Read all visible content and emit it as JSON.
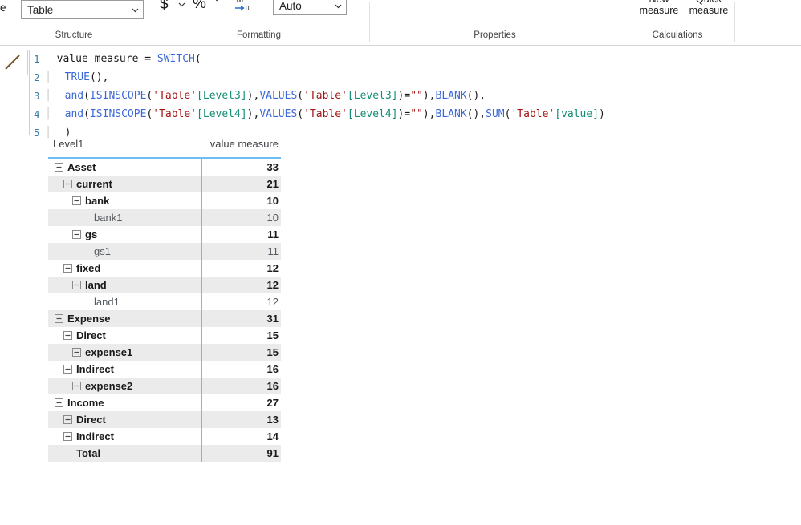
{
  "ribbon": {
    "structure": {
      "group_label": "Structure",
      "truncated_left_label": "e",
      "table_select_value": "Table",
      "table_select_options": [
        "Table"
      ]
    },
    "formatting": {
      "group_label": "Formatting",
      "currency_icon": "$",
      "currency_dropdown_icon": "chevron-down-icon",
      "percent_icon": "%",
      "thousands_icon": "'",
      "decrease_decimals_icon": "decrease-decimal-icon",
      "auto_select_value": "Auto",
      "auto_select_options": [
        "Auto"
      ]
    },
    "properties": {
      "group_label": "Properties"
    },
    "calculations": {
      "group_label": "Calculations",
      "new_measure_label": "New measure",
      "quick_measure_label": "Quick measure"
    }
  },
  "formula_bar": {
    "commit_icon": "checkmark-icon",
    "lines": [
      {
        "number": "1",
        "indent": 0,
        "tokens": [
          {
            "text": "value measure = ",
            "cls": "t-plain"
          },
          {
            "text": "SWITCH",
            "cls": "t-fn"
          },
          {
            "text": "(",
            "cls": "t-punc"
          }
        ]
      },
      {
        "number": "2",
        "indent": 1,
        "tokens": [
          {
            "text": "TRUE",
            "cls": "t-fn"
          },
          {
            "text": "(),",
            "cls": "t-punc"
          }
        ]
      },
      {
        "number": "3",
        "indent": 1,
        "tokens": [
          {
            "text": "and",
            "cls": "t-fn"
          },
          {
            "text": "(",
            "cls": "t-punc"
          },
          {
            "text": "ISINSCOPE",
            "cls": "t-fn"
          },
          {
            "text": "(",
            "cls": "t-punc"
          },
          {
            "text": "'Table'",
            "cls": "t-tbl"
          },
          {
            "text": "[Level3]",
            "cls": "t-col"
          },
          {
            "text": "),",
            "cls": "t-punc"
          },
          {
            "text": "VALUES",
            "cls": "t-fn"
          },
          {
            "text": "(",
            "cls": "t-punc"
          },
          {
            "text": "'Table'",
            "cls": "t-tbl"
          },
          {
            "text": "[Level3]",
            "cls": "t-col"
          },
          {
            "text": ")=",
            "cls": "t-punc"
          },
          {
            "text": "\"\"",
            "cls": "t-str"
          },
          {
            "text": "),",
            "cls": "t-punc"
          },
          {
            "text": "BLANK",
            "cls": "t-fn"
          },
          {
            "text": "(),",
            "cls": "t-punc"
          }
        ]
      },
      {
        "number": "4",
        "indent": 1,
        "tokens": [
          {
            "text": "and",
            "cls": "t-fn"
          },
          {
            "text": "(",
            "cls": "t-punc"
          },
          {
            "text": "ISINSCOPE",
            "cls": "t-fn"
          },
          {
            "text": "(",
            "cls": "t-punc"
          },
          {
            "text": "'Table'",
            "cls": "t-tbl"
          },
          {
            "text": "[Level4]",
            "cls": "t-col"
          },
          {
            "text": "),",
            "cls": "t-punc"
          },
          {
            "text": "VALUES",
            "cls": "t-fn"
          },
          {
            "text": "(",
            "cls": "t-punc"
          },
          {
            "text": "'Table'",
            "cls": "t-tbl"
          },
          {
            "text": "[Level4]",
            "cls": "t-col"
          },
          {
            "text": ")=",
            "cls": "t-punc"
          },
          {
            "text": "\"\"",
            "cls": "t-str"
          },
          {
            "text": "),",
            "cls": "t-punc"
          },
          {
            "text": "BLANK",
            "cls": "t-fn"
          },
          {
            "text": "(),",
            "cls": "t-punc"
          },
          {
            "text": "SUM",
            "cls": "t-fn"
          },
          {
            "text": "(",
            "cls": "t-punc"
          },
          {
            "text": "'Table'",
            "cls": "t-tbl"
          },
          {
            "text": "[value]",
            "cls": "t-col"
          },
          {
            "text": ")",
            "cls": "t-punc"
          }
        ]
      },
      {
        "number": "5",
        "indent": 1,
        "tokens": [
          {
            "text": ")",
            "cls": "t-punc"
          }
        ]
      }
    ]
  },
  "matrix": {
    "columns": {
      "row_header": "Level1",
      "value_header": "value measure"
    },
    "rows": [
      {
        "label": "Asset",
        "value": "33",
        "indent": 0,
        "expander": "collapse-icon",
        "style": "bold"
      },
      {
        "label": "current",
        "value": "21",
        "indent": 1,
        "expander": "collapse-icon",
        "style": "bold"
      },
      {
        "label": "bank",
        "value": "10",
        "indent": 2,
        "expander": "collapse-icon",
        "style": "bold"
      },
      {
        "label": "bank1",
        "value": "10",
        "indent": 3,
        "expander": "none",
        "style": "leaf"
      },
      {
        "label": "gs",
        "value": "11",
        "indent": 2,
        "expander": "collapse-icon",
        "style": "bold"
      },
      {
        "label": "gs1",
        "value": "11",
        "indent": 3,
        "expander": "none",
        "style": "leaf"
      },
      {
        "label": "fixed",
        "value": "12",
        "indent": 1,
        "expander": "collapse-icon",
        "style": "bold"
      },
      {
        "label": "land",
        "value": "12",
        "indent": 2,
        "expander": "collapse-icon",
        "style": "bold"
      },
      {
        "label": "land1",
        "value": "12",
        "indent": 3,
        "expander": "none",
        "style": "leaf"
      },
      {
        "label": "Expense",
        "value": "31",
        "indent": 0,
        "expander": "collapse-icon",
        "style": "bold"
      },
      {
        "label": "Direct",
        "value": "15",
        "indent": 1,
        "expander": "collapse-icon",
        "style": "bold"
      },
      {
        "label": "expense1",
        "value": "15",
        "indent": 2,
        "expander": "collapse-icon",
        "style": "bold"
      },
      {
        "label": "Indirect",
        "value": "16",
        "indent": 1,
        "expander": "collapse-icon",
        "style": "bold"
      },
      {
        "label": "expense2",
        "value": "16",
        "indent": 2,
        "expander": "collapse-icon",
        "style": "bold"
      },
      {
        "label": "Income",
        "value": "27",
        "indent": 0,
        "expander": "collapse-icon",
        "style": "bold"
      },
      {
        "label": "Direct",
        "value": "13",
        "indent": 1,
        "expander": "collapse-icon",
        "style": "bold"
      },
      {
        "label": "Indirect",
        "value": "14",
        "indent": 1,
        "expander": "collapse-icon",
        "style": "bold"
      },
      {
        "label": "Total",
        "value": "91",
        "indent": 1,
        "expander": "none",
        "style": "bold"
      }
    ]
  },
  "colors": {
    "accent_blue": "#6fbdf5",
    "row_stripe": "#ebebeb",
    "function_token": "#3d68d8",
    "table_token": "#a31515",
    "column_token": "#138d75",
    "line_number": "#3c7aa8"
  }
}
